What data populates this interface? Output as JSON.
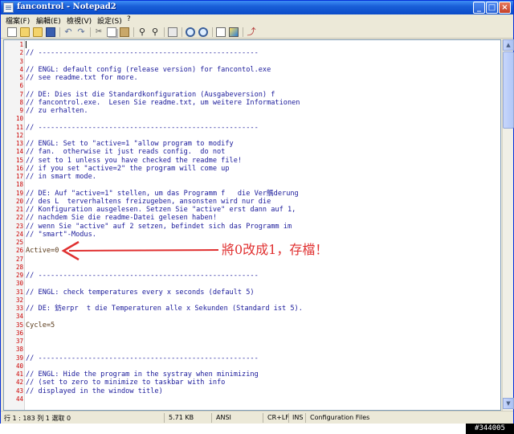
{
  "window": {
    "title": "fancontrol - Notepad2"
  },
  "menu": [
    "檔案(F)",
    "編輯(E)",
    "檢視(V)",
    "設定(S)",
    "?"
  ],
  "editor": {
    "lines": [
      {
        "n": "1",
        "text": ""
      },
      {
        "n": "2",
        "text": "// -----------------------------------------------------"
      },
      {
        "n": "3",
        "text": ""
      },
      {
        "n": "4",
        "text": "// ENGL: default config (release version) for fancontol.exe"
      },
      {
        "n": "5",
        "text": "// see readme.txt for more."
      },
      {
        "n": "6",
        "text": ""
      },
      {
        "n": "7",
        "text": "// DE: Dies ist die Standardkonfiguration (Ausgabeversion) f"
      },
      {
        "n": "8",
        "text": "// fancontrol.exe.  Lesen Sie readme.txt, um weitere Informationen"
      },
      {
        "n": "9",
        "text": "// zu erhalten."
      },
      {
        "n": "10",
        "text": ""
      },
      {
        "n": "11",
        "text": "// -----------------------------------------------------"
      },
      {
        "n": "12",
        "text": ""
      },
      {
        "n": "13",
        "text": "// ENGL: Set to \"active=1 \"allow program to modify"
      },
      {
        "n": "14",
        "text": "// fan.  otherwise it just reads config.  do not"
      },
      {
        "n": "15",
        "text": "// set to 1 unless you have checked the readme file!"
      },
      {
        "n": "16",
        "text": "// if you set \"active=2\" the program will come up"
      },
      {
        "n": "17",
        "text": "// in smart mode."
      },
      {
        "n": "18",
        "text": ""
      },
      {
        "n": "19",
        "text": "// DE: Auf \"active=1\" stellen, um das Programm f   die Ver鷌derung"
      },
      {
        "n": "20",
        "text": "// des L  terverhaltens freizugeben, ansonsten wird nur die"
      },
      {
        "n": "21",
        "text": "// Konfiguration ausgelesen. Setzen Sie \"active\" erst dann auf 1,"
      },
      {
        "n": "22",
        "text": "// nachdem Sie die readme-Datei gelesen haben!"
      },
      {
        "n": "23",
        "text": "// wenn Sie \"active\" auf 2 setzen, befindet sich das Programm im"
      },
      {
        "n": "24",
        "text": "// \"smart\"-Modus."
      },
      {
        "n": "25",
        "text": ""
      },
      {
        "n": "26",
        "text": "Active=0"
      },
      {
        "n": "27",
        "text": ""
      },
      {
        "n": "28",
        "text": ""
      },
      {
        "n": "29",
        "text": "// -----------------------------------------------------"
      },
      {
        "n": "30",
        "text": ""
      },
      {
        "n": "31",
        "text": "// ENGL: check temperatures every x seconds (default 5)"
      },
      {
        "n": "32",
        "text": ""
      },
      {
        "n": "33",
        "text": "// DE: 鈁erpr  t die Temperaturen alle x Sekunden (Standard ist 5)."
      },
      {
        "n": "34",
        "text": ""
      },
      {
        "n": "35",
        "text": "Cycle=5"
      },
      {
        "n": "36",
        "text": ""
      },
      {
        "n": "37",
        "text": ""
      },
      {
        "n": "38",
        "text": ""
      },
      {
        "n": "39",
        "text": "// -----------------------------------------------------"
      },
      {
        "n": "40",
        "text": ""
      },
      {
        "n": "41",
        "text": "// ENGL: Hide the program in the systray when minimizing"
      },
      {
        "n": "42",
        "text": "// (set to zero to minimize to taskbar with info"
      },
      {
        "n": "43",
        "text": "// displayed in the window title)"
      },
      {
        "n": "44",
        "text": ""
      }
    ]
  },
  "annotation": {
    "text": "將0改成1，存檔！",
    "color": "#e03030"
  },
  "status": {
    "position": "行 1 : 183   列 1   選取 0",
    "size": "5.71 KB",
    "encoding": "ANSI",
    "eol": "CR+LF",
    "ins": "INS",
    "scheme": "Configuration Files"
  },
  "watermark": "#344005"
}
